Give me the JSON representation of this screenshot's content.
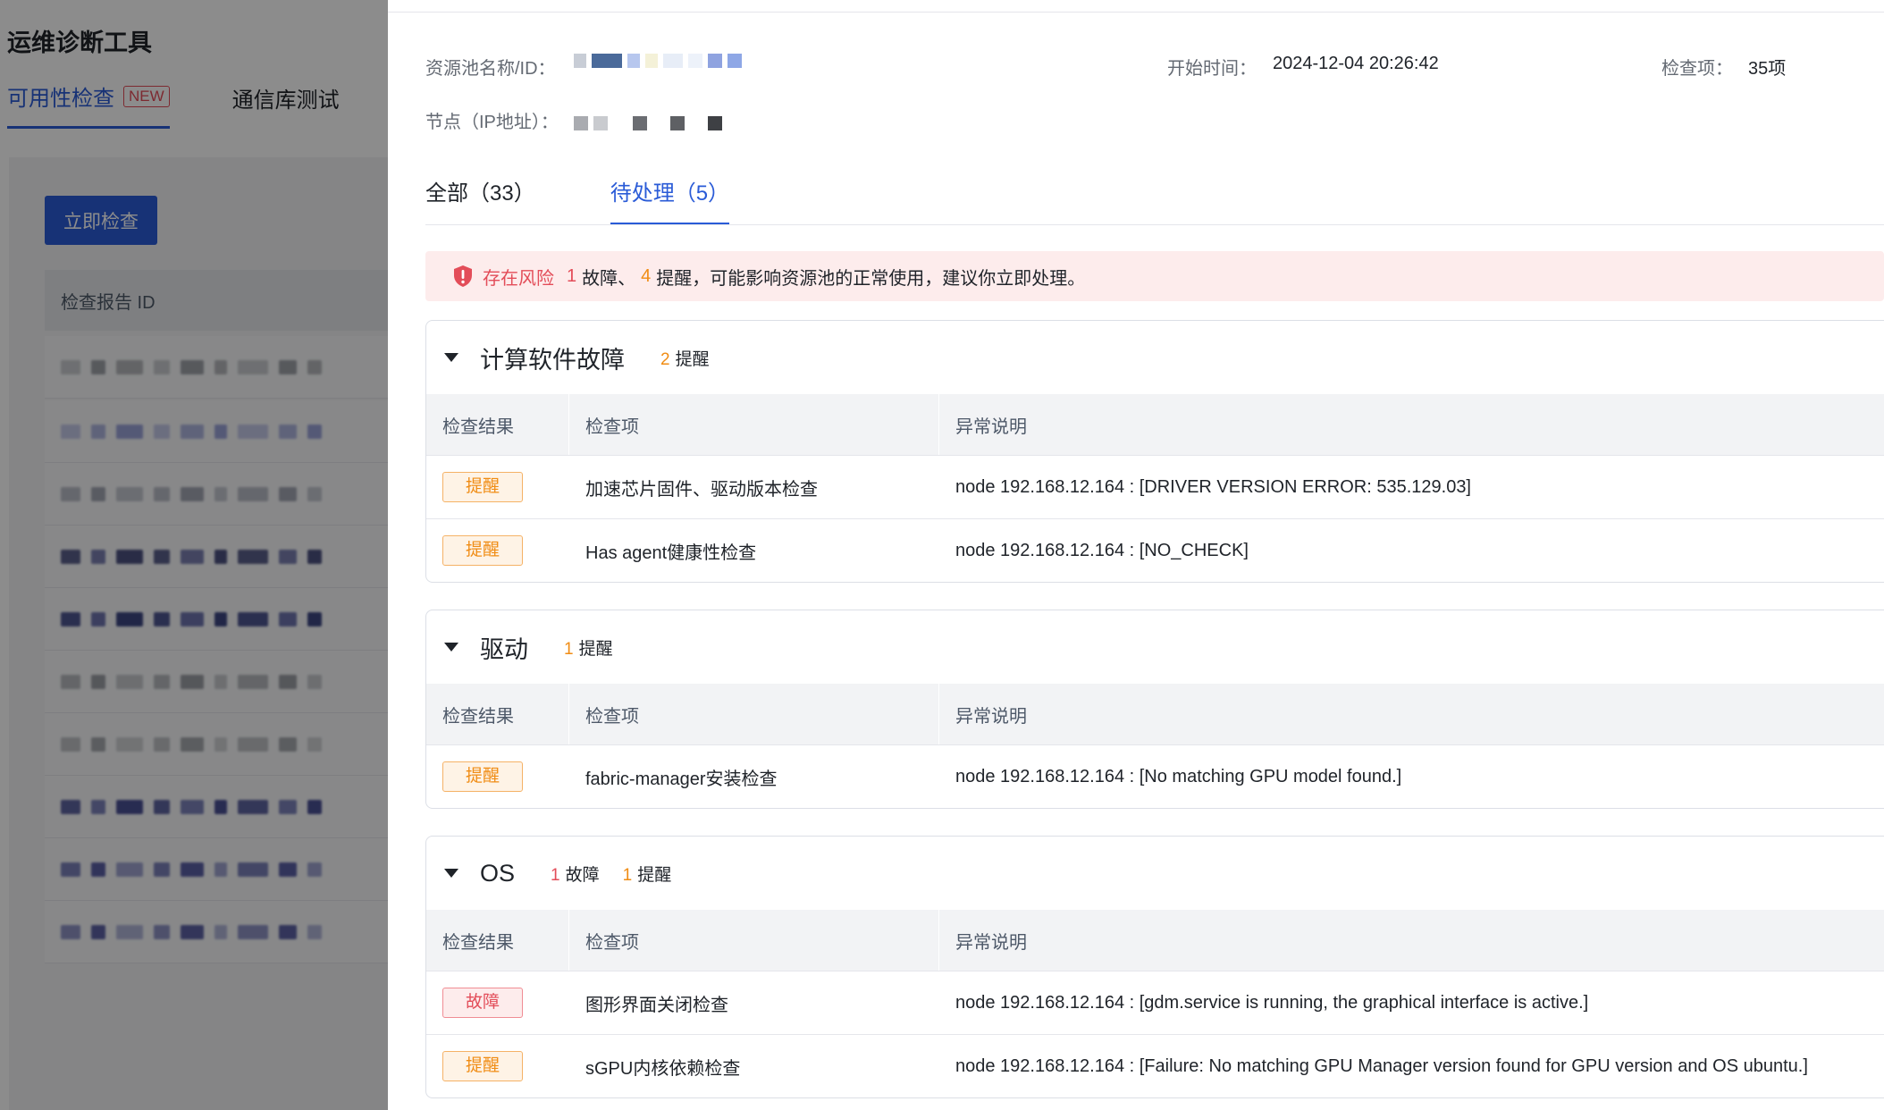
{
  "background": {
    "title": "运维诊断工具",
    "tabs": [
      {
        "label": "可用性检查",
        "badge": "NEW",
        "active": true
      },
      {
        "label": "通信库测试",
        "active": false
      }
    ],
    "check_button": "立即检查",
    "table_header": "检查报告 ID"
  },
  "drawer": {
    "pool_label": "资源池名称/ID：",
    "node_label": "节点（IP地址）：",
    "start_label": "开始时间：",
    "start_value": "2024-12-04 20:26:42",
    "items_label": "检查项：",
    "items_value": "35项",
    "tabs": [
      {
        "label": "全部（33）",
        "active": false
      },
      {
        "label": "待处理（5）",
        "active": true
      }
    ],
    "alert": {
      "risk": "存在风险",
      "fault_count": "1",
      "fault_text": "故障、",
      "warn_count": "4",
      "warn_text": "提醒，可能影响资源池的正常使用，建议你立即处理。"
    },
    "columns": [
      "检查结果",
      "检查项",
      "异常说明"
    ],
    "sections": [
      {
        "title": "计算软件故障",
        "counts": [
          {
            "n": "2",
            "label": "提醒",
            "kind": "warn"
          }
        ],
        "rows": [
          {
            "result": "提醒",
            "kind": "warn",
            "item": "加速芯片固件、驱动版本检查",
            "detail": "node 192.168.12.164 : [DRIVER VERSION ERROR: 535.129.03]"
          },
          {
            "result": "提醒",
            "kind": "warn",
            "item": "Has agent健康性检查",
            "detail": "node 192.168.12.164 : [NO_CHECK]"
          }
        ]
      },
      {
        "title": "驱动",
        "counts": [
          {
            "n": "1",
            "label": "提醒",
            "kind": "warn"
          }
        ],
        "rows": [
          {
            "result": "提醒",
            "kind": "warn",
            "item": "fabric-manager安装检查",
            "detail": "node 192.168.12.164 : [No matching GPU model found.]"
          }
        ]
      },
      {
        "title": "OS",
        "counts": [
          {
            "n": "1",
            "label": "故障",
            "kind": "fault"
          },
          {
            "n": "1",
            "label": "提醒",
            "kind": "warn"
          }
        ],
        "rows": [
          {
            "result": "故障",
            "kind": "fault",
            "item": "图形界面关闭检查",
            "detail": "node 192.168.12.164 : [gdm.service is running, the graphical interface is active.]"
          },
          {
            "result": "提醒",
            "kind": "warn",
            "item": "sGPU内核依赖检查",
            "detail": "node 192.168.12.164 : [Failure: No matching GPU Manager version found for GPU version and OS ubuntu.]"
          }
        ]
      }
    ]
  }
}
